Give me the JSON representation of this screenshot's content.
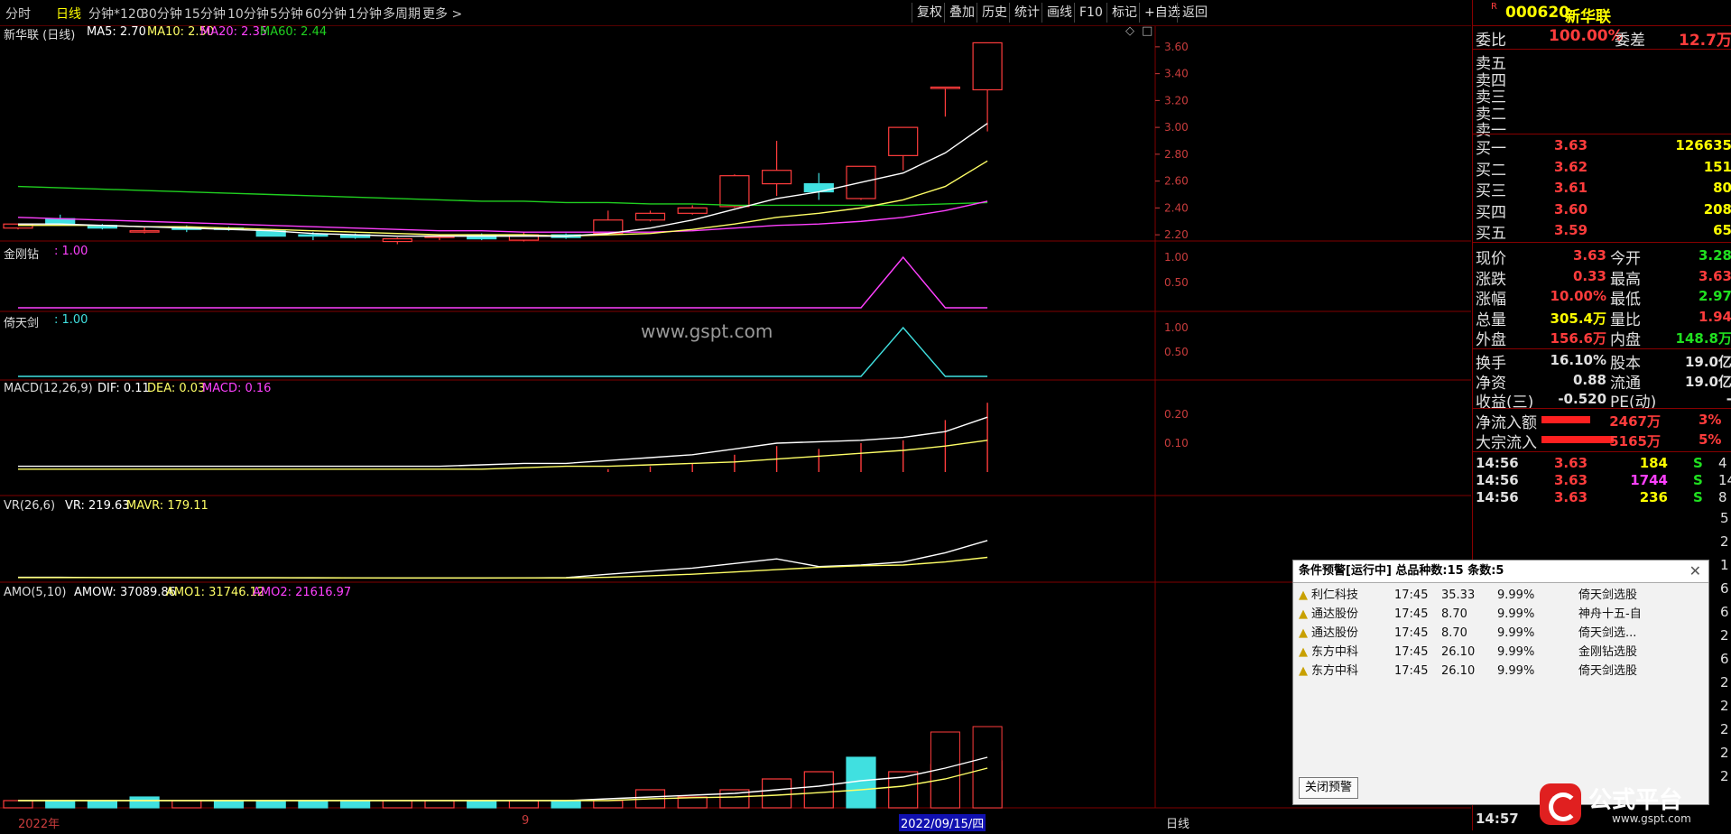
{
  "toolbar": {
    "periods": [
      "分时",
      "日线",
      "分钟*120",
      "30分钟",
      "15分钟",
      "10分钟",
      "5分钟",
      "60分钟",
      "1分钟",
      "多周期",
      "更多 >"
    ],
    "active_period": "日线",
    "right_buttons": [
      "复权",
      "叠加",
      "历史",
      "统计",
      "画线",
      "F10",
      "标记",
      "+自选",
      "返回"
    ]
  },
  "main_panel": {
    "title": "新华联 (日线)",
    "ma5": "MA5: 2.70",
    "ma10": "MA10: 2.50",
    "ma20": "MA20: 2.35",
    "ma60": "MA60: 2.44",
    "y_ticks": [
      "3.60",
      "3.40",
      "3.20",
      "3.00",
      "2.80",
      "2.60",
      "2.40",
      "2.20"
    ]
  },
  "jgz_panel": {
    "name": "金刚钻",
    "value": ": 1.00",
    "y_ticks": [
      "1.00",
      "0.50"
    ]
  },
  "ytj_panel": {
    "name": "倚天剑",
    "value": ": 1.00",
    "y_ticks": [
      "1.00",
      "0.50"
    ]
  },
  "macd_panel": {
    "name": "MACD(12,26,9)",
    "dif": "DIF: 0.11",
    "dea": "DEA: 0.03",
    "macd": "MACD: 0.16",
    "y_ticks": [
      "0.20",
      "0.10"
    ]
  },
  "vr_panel": {
    "name": "VR(26,6)",
    "vr": "VR: 219.63",
    "mavr": "MAVR: 179.11"
  },
  "amo_panel": {
    "name": "AMO(5,10)",
    "amow": "AMOW: 37089.86",
    "amo1": "AMO1: 31746.12",
    "amo2": "AMO2: 21616.97"
  },
  "watermark": "www.gspt.com",
  "x_axis": {
    "start": "2022年",
    "mid": "9",
    "cursor_date": "2022/09/15/四",
    "period": "日线"
  },
  "quote": {
    "code": "000620",
    "name": "新华联",
    "flag": "R",
    "wei_bi_label": "委比",
    "wei_bi": "100.00%",
    "wei_cha_label": "委差",
    "wei_cha": "12.7万",
    "sells": [
      "卖五",
      "卖四",
      "卖三",
      "卖二",
      "卖一"
    ],
    "buys": [
      {
        "label": "买一",
        "price": "3.63",
        "vol": "126635"
      },
      {
        "label": "买二",
        "price": "3.62",
        "vol": "151"
      },
      {
        "label": "买三",
        "price": "3.61",
        "vol": "80"
      },
      {
        "label": "买四",
        "price": "3.60",
        "vol": "208"
      },
      {
        "label": "买五",
        "price": "3.59",
        "vol": "65"
      }
    ],
    "stats1": [
      {
        "l1": "现价",
        "v1": "3.63",
        "l2": "今开",
        "v2": "3.28"
      },
      {
        "l1": "涨跌",
        "v1": "0.33",
        "l2": "最高",
        "v2": "3.63"
      },
      {
        "l1": "涨幅",
        "v1": "10.00%",
        "l2": "最低",
        "v2": "2.97"
      },
      {
        "l1": "总量",
        "v1": "305.4万",
        "l2": "量比",
        "v2": "1.94"
      },
      {
        "l1": "外盘",
        "v1": "156.6万",
        "l2": "内盘",
        "v2": "148.8万"
      }
    ],
    "stats2": [
      {
        "l1": "换手",
        "v1": "16.10%",
        "l2": "股本",
        "v2": "19.0亿"
      },
      {
        "l1": "净资",
        "v1": "0.88",
        "l2": "流通",
        "v2": "19.0亿"
      },
      {
        "l1": "收益(三)",
        "v1": "-0.520",
        "l2": "PE(动)",
        "v2": "-"
      }
    ],
    "flows": [
      {
        "label": "净流入额",
        "value": "2467万",
        "pct": "3%"
      },
      {
        "label": "大宗流入",
        "value": "5165万",
        "pct": "5%"
      }
    ],
    "ticks": [
      {
        "time": "14:56",
        "price": "3.63",
        "vol": "184",
        "side": "S",
        "n": "4"
      },
      {
        "time": "14:56",
        "price": "3.63",
        "vol": "1744",
        "side": "S",
        "n": "14"
      },
      {
        "time": "14:56",
        "price": "3.63",
        "vol": "236",
        "side": "S",
        "n": "8"
      }
    ],
    "extra_ticks": [
      {
        "time": "14:57"
      }
    ],
    "right_edge_digits": [
      "5",
      "2",
      "1",
      "6",
      "6",
      "2",
      "6",
      "2",
      "2",
      "2",
      "2",
      "2"
    ]
  },
  "alert": {
    "title": "条件预警[运行中] 总品种数:15 条数:5",
    "rows": [
      {
        "name": "利仁科技",
        "time": "17:45",
        "price": "35.33",
        "pct": "9.99%",
        "strategy": "倚天剑选股"
      },
      {
        "name": "通达股份",
        "time": "17:45",
        "price": "8.70",
        "pct": "9.99%",
        "strategy": "神舟十五-自"
      },
      {
        "name": "通达股份",
        "time": "17:45",
        "price": "8.70",
        "pct": "9.99%",
        "strategy": "倚天剑选..."
      },
      {
        "name": "东方中科",
        "time": "17:45",
        "price": "26.10",
        "pct": "9.99%",
        "strategy": "金刚钻选股"
      },
      {
        "name": "东方中科",
        "time": "17:45",
        "price": "26.10",
        "pct": "9.99%",
        "strategy": "倚天剑选股"
      }
    ],
    "close_button": "关闭预警",
    "close_x": "✕"
  },
  "logo": {
    "text": "公式平台",
    "url": "www.gspt.com"
  },
  "colors": {
    "up": "#ff3c3c",
    "down": "#40e0e0",
    "ma5": "#ffffff",
    "ma10": "#ffff66",
    "ma20": "#ff40ff",
    "ma60": "#20d020",
    "grid": "#800000"
  },
  "chart_data": {
    "type": "candlestick",
    "candles": [
      {
        "o": 2.25,
        "h": 2.28,
        "l": 2.24,
        "c": 2.28
      },
      {
        "o": 2.32,
        "h": 2.35,
        "l": 2.27,
        "c": 2.28
      },
      {
        "o": 2.27,
        "h": 2.28,
        "l": 2.24,
        "c": 2.25
      },
      {
        "o": 2.23,
        "h": 2.26,
        "l": 2.21,
        "c": 2.23
      },
      {
        "o": 2.25,
        "h": 2.27,
        "l": 2.22,
        "c": 2.24
      },
      {
        "o": 2.25,
        "h": 2.26,
        "l": 2.23,
        "c": 2.24
      },
      {
        "o": 2.23,
        "h": 2.24,
        "l": 2.19,
        "c": 2.19
      },
      {
        "o": 2.2,
        "h": 2.22,
        "l": 2.16,
        "c": 2.19
      },
      {
        "o": 2.2,
        "h": 2.21,
        "l": 2.17,
        "c": 2.18
      },
      {
        "o": 2.15,
        "h": 2.18,
        "l": 2.13,
        "c": 2.17
      },
      {
        "o": 2.18,
        "h": 2.2,
        "l": 2.16,
        "c": 2.19
      },
      {
        "o": 2.2,
        "h": 2.21,
        "l": 2.16,
        "c": 2.17
      },
      {
        "o": 2.16,
        "h": 2.22,
        "l": 2.15,
        "c": 2.2
      },
      {
        "o": 2.2,
        "h": 2.21,
        "l": 2.17,
        "c": 2.18
      },
      {
        "o": 2.21,
        "h": 2.38,
        "l": 2.2,
        "c": 2.31
      },
      {
        "o": 2.31,
        "h": 2.38,
        "l": 2.3,
        "c": 2.36
      },
      {
        "o": 2.36,
        "h": 2.42,
        "l": 2.35,
        "c": 2.4
      },
      {
        "o": 2.41,
        "h": 2.65,
        "l": 2.4,
        "c": 2.64
      },
      {
        "o": 2.58,
        "h": 2.9,
        "l": 2.49,
        "c": 2.68
      },
      {
        "o": 2.58,
        "h": 2.66,
        "l": 2.46,
        "c": 2.52
      },
      {
        "o": 2.47,
        "h": 2.71,
        "l": 2.46,
        "c": 2.71
      },
      {
        "o": 2.79,
        "h": 3.0,
        "l": 2.68,
        "c": 3.0
      },
      {
        "o": 3.3,
        "h": 3.3,
        "l": 3.08,
        "c": 3.3
      },
      {
        "o": 3.28,
        "h": 3.63,
        "l": 2.97,
        "c": 3.63
      }
    ],
    "ma5": [
      2.28,
      2.28,
      2.27,
      2.26,
      2.25,
      2.24,
      2.23,
      2.21,
      2.2,
      2.19,
      2.19,
      2.19,
      2.19,
      2.19,
      2.21,
      2.25,
      2.31,
      2.39,
      2.47,
      2.52,
      2.59,
      2.66,
      2.81,
      3.03
    ],
    "ma10": [
      2.27,
      2.27,
      2.27,
      2.26,
      2.26,
      2.25,
      2.24,
      2.23,
      2.22,
      2.21,
      2.2,
      2.2,
      2.2,
      2.19,
      2.2,
      2.21,
      2.24,
      2.28,
      2.33,
      2.36,
      2.4,
      2.46,
      2.56,
      2.75
    ],
    "ma20": [
      2.33,
      2.32,
      2.31,
      2.3,
      2.29,
      2.28,
      2.27,
      2.26,
      2.25,
      2.24,
      2.23,
      2.23,
      2.22,
      2.22,
      2.22,
      2.22,
      2.23,
      2.25,
      2.27,
      2.28,
      2.3,
      2.33,
      2.38,
      2.45
    ],
    "ma60": [
      2.56,
      2.55,
      2.54,
      2.53,
      2.52,
      2.51,
      2.5,
      2.49,
      2.48,
      2.47,
      2.46,
      2.45,
      2.45,
      2.44,
      2.44,
      2.43,
      2.43,
      2.42,
      2.42,
      2.42,
      2.42,
      2.42,
      2.43,
      2.44
    ],
    "ylim": [
      2.1,
      3.7
    ]
  }
}
